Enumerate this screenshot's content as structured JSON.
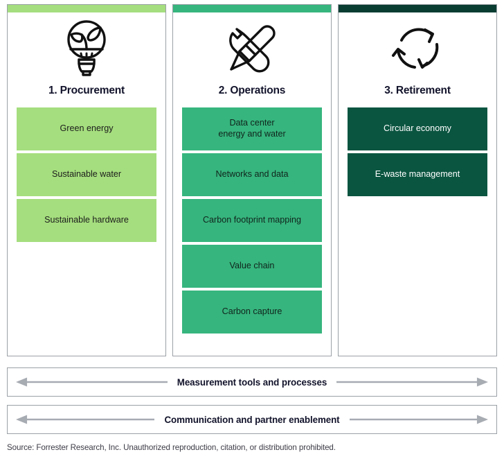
{
  "columns": [
    {
      "id": "procurement",
      "title": "1. Procurement",
      "icon": "lightbulb-plant-icon",
      "accent": "#A5DE7E",
      "bar_color": "#A5DE7E",
      "tone": "light",
      "items": [
        "Green energy",
        "Sustainable water",
        "Sustainable hardware"
      ]
    },
    {
      "id": "operations",
      "title": "2. Operations",
      "icon": "wrench-screwdriver-icon",
      "accent": "#36B57E",
      "bar_color": "#36B57E",
      "tone": "mid",
      "items": [
        "Data center\nenergy and water",
        "Networks and data",
        "Carbon footprint mapping",
        "Value chain",
        "Carbon capture"
      ]
    },
    {
      "id": "retirement",
      "title": "3. Retirement",
      "icon": "circular-arrows-icon",
      "accent": "#0A5540",
      "bar_color": "#0A3D32",
      "tone": "dark",
      "items": [
        "Circular economy",
        "E-waste management"
      ]
    }
  ],
  "bands": [
    {
      "id": "measurement",
      "label": "Measurement tools and processes"
    },
    {
      "id": "communication",
      "label": "Communication and partner enablement"
    }
  ],
  "source": "Source: Forrester Research, Inc. Unauthorized reproduction, citation, or distribution prohibited.",
  "colors": {
    "light_green": "#A5DE7E",
    "mid_green": "#36B57E",
    "dark_green": "#0A5540",
    "dark_green_bar": "#0A3D32",
    "panel_border": "#9AA0A6",
    "arrow_gray": "#A7ABB2",
    "title_text": "#12132B",
    "source_text": "#3B3B46"
  }
}
